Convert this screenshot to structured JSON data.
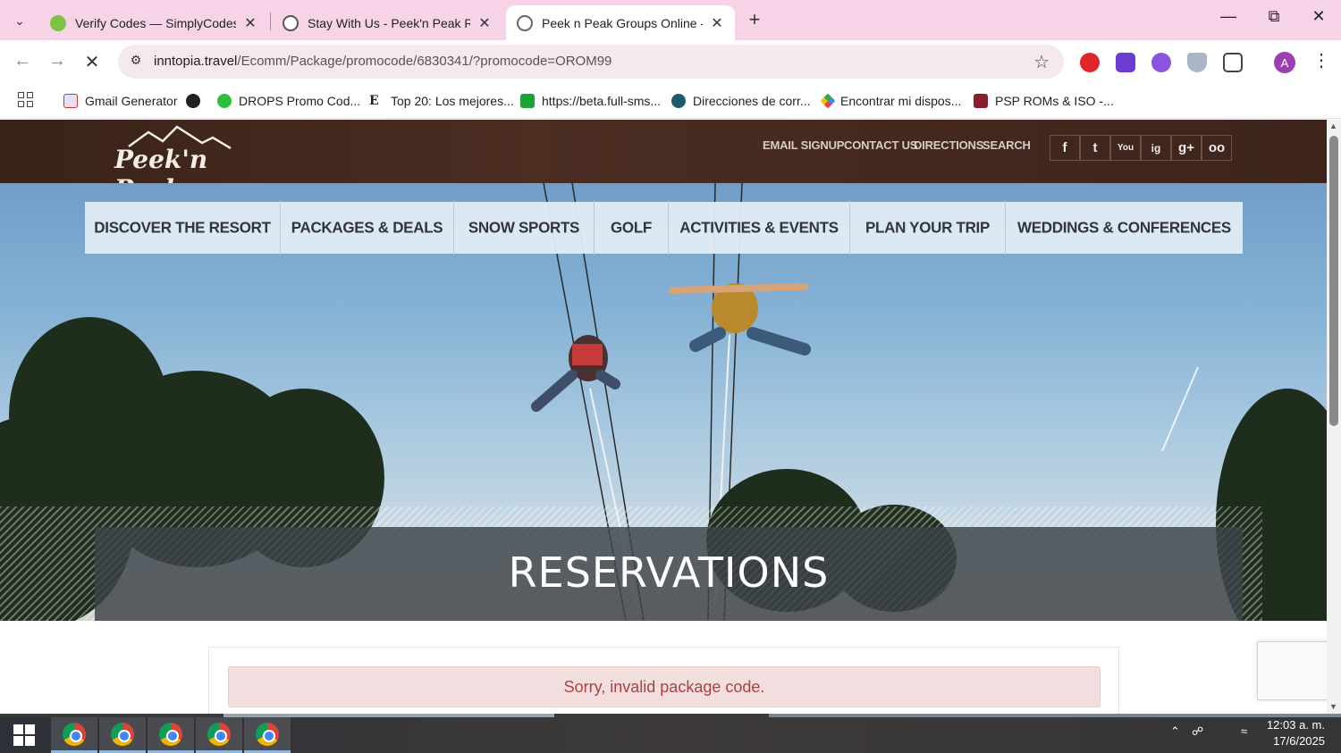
{
  "browser": {
    "tabs": [
      {
        "title": "Verify Codes — SimplyCodes",
        "active": false
      },
      {
        "title": "Stay With Us - Peek'n Peak Reso",
        "active": false
      },
      {
        "title": "Peek n Peak Groups Online - Pr",
        "active": true
      }
    ],
    "url_host": "inntopia.travel",
    "url_path": "/Ecomm/Package/promocode/6830341/?promocode=OROM99",
    "bookmarks": [
      "Gmail Generator",
      "DROPS Promo Cod...",
      "Top 20: Los mejores...",
      "https://beta.full-sms...",
      "Direcciones de corr...",
      "Encontrar mi dispos...",
      "PSP ROMs & ISO -..."
    ],
    "profile_initial": "A"
  },
  "site": {
    "logo_text": "Peek'n Peak",
    "utility_links": [
      "EMAIL SIGNUP",
      "CONTACT US",
      "DIRECTIONS",
      "SEARCH"
    ],
    "social": [
      "f",
      "t",
      "You",
      "ig",
      "g+",
      "oo"
    ],
    "nav": [
      "DISCOVER THE RESORT",
      "PACKAGES & DEALS",
      "SNOW SPORTS",
      "GOLF",
      "ACTIVITIES & EVENTS",
      "PLAN YOUR TRIP",
      "WEDDINGS & CONFERENCES"
    ],
    "banner_title": "RESERVATIONS",
    "alert_message": "Sorry, invalid package code."
  },
  "taskbar": {
    "time": "12:03 a. m.",
    "date": "17/6/2025"
  },
  "colors": {
    "tabstrip": "#f6d3e6",
    "header_brown": "#3a2218",
    "alert_text": "#a94442",
    "alert_bg": "#f2dede"
  }
}
